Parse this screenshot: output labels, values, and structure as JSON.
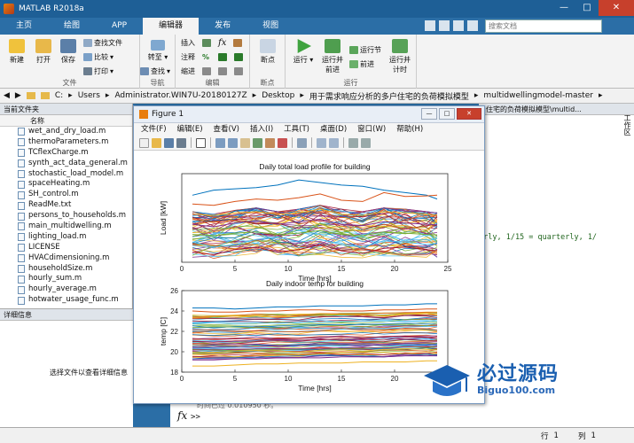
{
  "app": {
    "title": "MATLAB R2018a"
  },
  "tabs": [
    "主页",
    "绘图",
    "APP",
    "编辑器",
    "发布",
    "视图"
  ],
  "search_placeholder": "搜索文档",
  "ribbon": {
    "file_group": {
      "new": "新建",
      "open": "打开",
      "save": "保存",
      "find_files": "查找文件",
      "compare": "比较",
      "print": "打印",
      "label": "文件"
    },
    "nav_group": {
      "insert": "插入",
      "comment": "注释",
      "indent": "缩进",
      "goto": "转至",
      "find": "查找",
      "label": "导航"
    },
    "edit_group": {
      "label": "编辑"
    },
    "breakpoints": {
      "breakpoint": "断点",
      "label": "断点"
    },
    "run_group": {
      "run": "运行",
      "run_advance_l1": "运行并",
      "run_advance_l2": "前进",
      "run_section": "运行节",
      "advance": "前进",
      "run_time_l1": "运行并",
      "run_time_l2": "计时",
      "label": "运行"
    }
  },
  "address": {
    "segments": [
      "C:",
      "Users",
      "Administrator.WIN7U-20180127Z",
      "Desktop",
      "用于需求响应分析的多户住宅的负荷模拟模型",
      "multidwellingmodel-master"
    ]
  },
  "current_folder": {
    "title": "当前文件夹",
    "column": "名称",
    "files": [
      "wet_and_dry_load.m",
      "thermoParameters.m",
      "TCflexCharge.m",
      "synth_act_data_general.m",
      "stochastic_load_model.m",
      "spaceHeating.m",
      "SH_control.m",
      "ReadMe.txt",
      "persons_to_households.m",
      "main_multidwelling.m",
      "lighting_load.m",
      "LICENSE",
      "HVACdimensioning.m",
      "householdSize.m",
      "hourly_sum.m",
      "hourly_average.m",
      "hotwater_usage_func.m"
    ]
  },
  "details": {
    "title": "详细信息",
    "message": "选择文件以查看详细信息"
  },
  "right_panel": {
    "header": "住宅的负荷模拟模型\\multid...",
    "vertical_label": "工作区",
    "code_line": "arly, 1/15 = quarterly, 1/"
  },
  "command": {
    "prompt": ">>",
    "faded": "时间已过 0.010950 秒。"
  },
  "status": {
    "line_label": "行",
    "line_value": "1",
    "col_label": "列",
    "col_value": "1"
  },
  "figure": {
    "title": "Figure 1",
    "menu": [
      "文件(F)",
      "编辑(E)",
      "查看(V)",
      "插入(I)",
      "工具(T)",
      "桌面(D)",
      "窗口(W)",
      "帮助(H)"
    ]
  },
  "watermark": {
    "title": "必过源码",
    "subtitle": "Biguo100.com"
  },
  "colors": {
    "titlebar": "#1e5f96",
    "accent": "#2b6ea6",
    "line_blue": "#0072bd",
    "line_red": "#d95319"
  },
  "chart_data": [
    {
      "type": "line",
      "title": "Daily total load profile for building",
      "xlabel": "Time [hrs]",
      "ylabel": "Load [kW]",
      "xlim": [
        0,
        25
      ],
      "ylim": [
        0,
        350
      ],
      "x_ticks": [
        0,
        5,
        10,
        15,
        20,
        25
      ],
      "x": [
        1,
        3,
        5,
        7,
        9,
        11,
        13,
        15,
        17,
        19,
        21,
        23,
        24
      ],
      "series": [
        {
          "values": [
            265,
            285,
            290,
            295,
            305,
            325,
            315,
            305,
            300,
            285,
            275,
            265,
            250
          ]
        },
        {
          "values": [
            230,
            225,
            240,
            250,
            245,
            255,
            270,
            245,
            240,
            275,
            260,
            262,
            265
          ]
        },
        {
          "values": [
            190,
            185,
            195,
            200,
            190,
            195,
            210,
            190,
            185,
            200,
            195,
            190,
            185
          ]
        },
        {
          "values": [
            150,
            140,
            155,
            165,
            150,
            160,
            170,
            150,
            145,
            160,
            155,
            150,
            148
          ]
        },
        {
          "values": [
            110,
            105,
            115,
            120,
            110,
            115,
            125,
            110,
            105,
            120,
            115,
            110,
            108
          ]
        },
        {
          "values": [
            80,
            60,
            70,
            90,
            100,
            80,
            90,
            70,
            60,
            85,
            80,
            70,
            75
          ]
        },
        {
          "values": [
            40,
            30,
            50,
            60,
            40,
            50,
            70,
            45,
            35,
            55,
            60,
            50,
            45
          ]
        }
      ],
      "band": {
        "low": [
          20,
          15,
          25,
          30,
          30,
          25,
          30,
          20,
          15,
          25,
          25,
          20,
          20
        ],
        "high": [
          200,
          190,
          205,
          215,
          200,
          210,
          225,
          210,
          200,
          215,
          210,
          200,
          195
        ]
      },
      "grid": false
    },
    {
      "type": "line",
      "title": "Daily indoor temp for building",
      "xlabel": "Time [hrs]",
      "ylabel": "temp [C]",
      "xlim": [
        0,
        25
      ],
      "ylim": [
        18,
        26
      ],
      "x_ticks": [
        0,
        5,
        10,
        15,
        20,
        25
      ],
      "y_ticks": [
        18,
        20,
        22,
        24,
        26
      ],
      "x": [
        1,
        3,
        5,
        7,
        9,
        11,
        13,
        15,
        17,
        19,
        21,
        23,
        24
      ],
      "series": [
        {
          "values": [
            24.3,
            24.3,
            24.2,
            24.3,
            24.4,
            24.4,
            24.5,
            24.5,
            24.5,
            24.6,
            24.6,
            24.7,
            24.7
          ]
        },
        {
          "values": [
            24.0,
            23.9,
            23.9,
            24.0,
            24.0,
            24.1,
            24.1,
            24.0,
            24.0,
            24.1,
            24.1,
            24.2,
            24.2
          ]
        },
        {
          "values": [
            18.6,
            18.6,
            18.7,
            18.8,
            18.8,
            18.9,
            18.9,
            18.9,
            19.0,
            19.0,
            19.0,
            19.1,
            19.1
          ]
        },
        {
          "values": [
            19.2,
            19.2,
            19.3,
            19.3,
            19.4,
            19.4,
            19.4,
            19.5,
            19.5,
            19.5,
            19.6,
            19.6,
            19.6
          ]
        }
      ],
      "band": {
        "low": [
          19.3,
          19.3,
          19.3,
          19.4,
          19.4,
          19.4,
          19.5,
          19.5,
          19.5,
          19.5,
          19.6,
          19.6,
          19.6
        ],
        "high": [
          23.6,
          23.6,
          23.6,
          23.7,
          23.7,
          23.7,
          23.8,
          23.8,
          23.8,
          23.8,
          23.9,
          23.9,
          23.9
        ]
      },
      "grid": false
    }
  ]
}
